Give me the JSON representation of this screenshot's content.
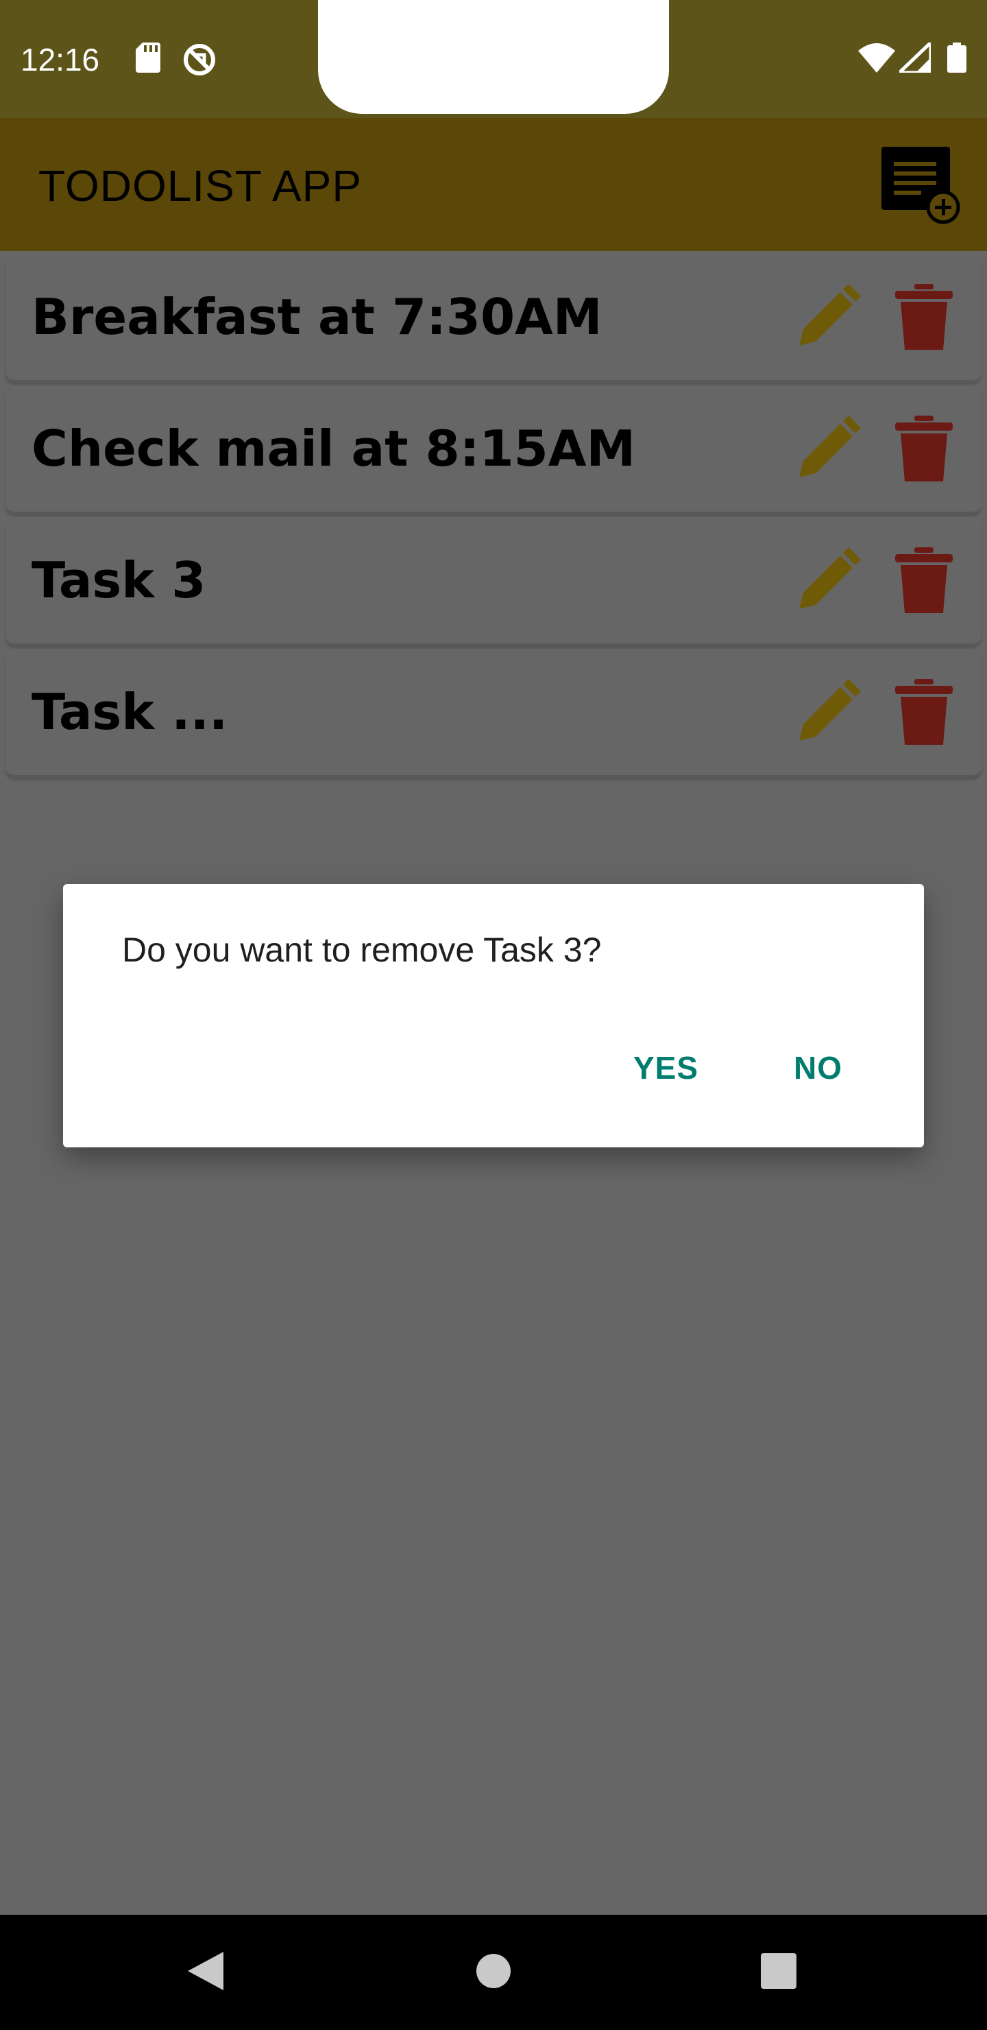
{
  "status_bar": {
    "time": "12:16",
    "icons": [
      "sd-card-icon",
      "sync-off-icon",
      "wifi-icon",
      "cell-signal-icon",
      "battery-icon"
    ]
  },
  "app_bar": {
    "title": "TODOLIST APP",
    "action_icon": "add-list-icon"
  },
  "tasks": [
    {
      "title": "Breakfast at 7:30AM"
    },
    {
      "title": "Check mail at 8:15AM"
    },
    {
      "title": "Task 3"
    },
    {
      "title": "Task ..."
    }
  ],
  "dialog": {
    "message": "Do you want to remove Task 3?",
    "yes_label": "YES",
    "no_label": "NO"
  },
  "nav_bar": {
    "icons": [
      "back-icon",
      "home-icon",
      "recents-icon"
    ]
  },
  "colors": {
    "status_bar": "#5d5419",
    "app_bar": "#5b4707",
    "scrim": "#666666",
    "edit_icon": "#6e5a07",
    "delete_icon": "#6b1a14",
    "dialog_accent": "#017d70"
  }
}
